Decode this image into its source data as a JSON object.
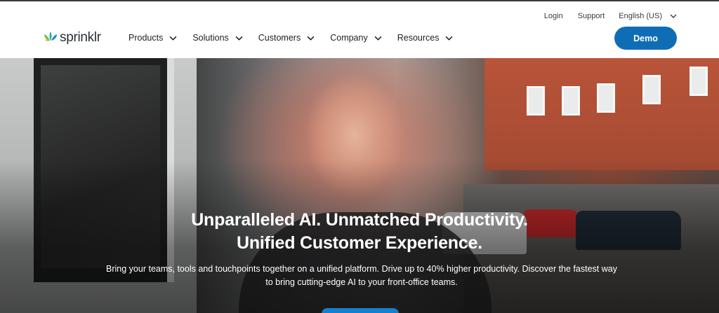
{
  "header": {
    "logo_text": "sprinklr",
    "utility": {
      "login": "Login",
      "support": "Support",
      "language": "English (US)"
    },
    "nav": [
      {
        "label": "Products"
      },
      {
        "label": "Solutions"
      },
      {
        "label": "Customers"
      },
      {
        "label": "Company"
      },
      {
        "label": "Resources"
      }
    ],
    "demo_label": "Demo"
  },
  "hero": {
    "title_line1": "Unparalleled AI. Unmatched Productivity.",
    "title_line2": "Unified Customer Experience.",
    "subtitle_line1": "Bring your teams, tools and touchpoints together on a unified platform. Drive up to 40% higher productivity. Discover the fastest way",
    "subtitle_line2": "to bring cutting-edge AI to your front-office teams."
  },
  "colors": {
    "brand_blue": "#0f6db6",
    "logo_green": "#6cc04a",
    "logo_blue": "#1f8ccf",
    "logo_orange": "#f5a623",
    "logo_teal": "#1bb3a6"
  },
  "icons": {
    "logo_mark": "sprinklr-flower-icon",
    "chevron": "chevron-down-icon"
  }
}
